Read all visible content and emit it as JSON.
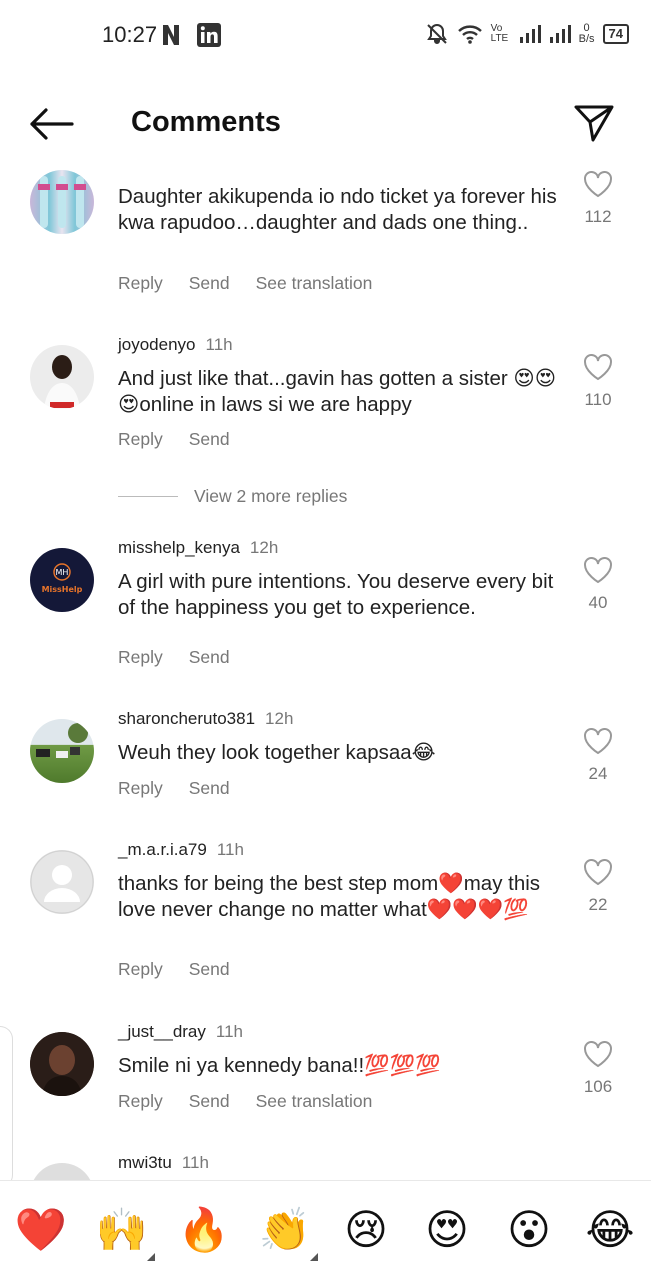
{
  "status_bar": {
    "time": "10:27",
    "lte": "Vo LTE",
    "net_speed": "0",
    "net_unit": "B/s",
    "battery": "74"
  },
  "header": {
    "title": "Comments"
  },
  "comments": [
    {
      "username": "",
      "time": "",
      "text": "Daughter akikupenda io ndo ticket ya forever his kwa rapudoo…daughter and dads one thing..",
      "reply": "Reply",
      "send": "Send",
      "translate": "See translation",
      "likes": "112"
    },
    {
      "username": "joyodenyo",
      "time": "11h",
      "text": "And just like that...gavin has gotten a sister 😍😍😍online in laws si we are happy",
      "reply": "Reply",
      "send": "Send",
      "likes": "110"
    },
    {
      "username": "misshelp_kenya",
      "time": "12h",
      "text": "A girl with pure intentions. You deserve every bit of the happiness you get to experience.",
      "reply": "Reply",
      "send": "Send",
      "likes": "40",
      "avatar_text": "MissHelp"
    },
    {
      "username": "sharoncheruto381",
      "time": "12h",
      "text": "Weuh they look together kapsaa😂",
      "reply": "Reply",
      "send": "Send",
      "likes": "24"
    },
    {
      "username": "_m.a.r.i.a79",
      "time": "11h",
      "text": "thanks for being the best step mom❤️may this love never change no matter what❤️❤️❤️💯",
      "reply": "Reply",
      "send": "Send",
      "likes": "22"
    },
    {
      "username": "_just__dray",
      "time": "11h",
      "text": "Smile ni ya kennedy bana!!💯💯💯",
      "reply": "Reply",
      "send": "Send",
      "translate": "See translation",
      "likes": "106"
    },
    {
      "username": "mwi3tu",
      "time": "11h"
    }
  ],
  "more_replies": "View 2 more replies",
  "emoji_bar": [
    "❤️",
    "🙌",
    "🔥",
    "👏",
    "😢",
    "😍",
    "😮",
    "😂"
  ],
  "colors": {
    "muted": "#777777",
    "heart": "#e0245e"
  }
}
